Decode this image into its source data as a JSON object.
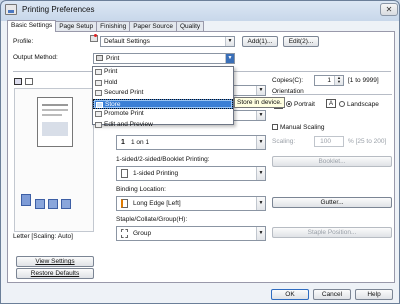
{
  "window": {
    "title": "Printing Preferences",
    "close": "✕"
  },
  "tabs": [
    "Basic Settings",
    "Page Setup",
    "Finishing",
    "Paper Source",
    "Quality"
  ],
  "profile": {
    "label": "Profile:",
    "value": "Default Settings",
    "add": "Add(1)...",
    "edit": "Edit(2)..."
  },
  "output_method": {
    "label": "Output Method:",
    "value": "Print",
    "options": [
      "Print",
      "Hold",
      "Secured Print",
      "Store",
      "Promote Print",
      "Edit and Preview"
    ],
    "selected_index": 3
  },
  "tooltip": "Store in device.",
  "copies": {
    "label": "Copies(C):",
    "value": "1",
    "range": "[1 to 9999]"
  },
  "orientation": {
    "label": "Orientation",
    "portrait": "Portrait",
    "landscape": "Landscape"
  },
  "layout_value": "1 on 1",
  "sided": {
    "label": "1-sided/2-sided/Booklet Printing:",
    "value": "1-sided Printing"
  },
  "binding": {
    "label": "Binding Location:",
    "value": "Long Edge [Left]",
    "gutter": "Gutter..."
  },
  "staple": {
    "label": "Staple/Collate/Group(H):",
    "value": "Group",
    "position": "Staple Position..."
  },
  "scaling": {
    "label": "Manual Scaling",
    "scaling_label": "Scaling:",
    "value": "100",
    "range": "% [25 to 200]"
  },
  "booklet": "Booklet...",
  "preview_caption": "Letter [Scaling: Auto]",
  "view_settings": "View Settings",
  "restore_defaults": "Restore Defaults",
  "footer": {
    "ok": "OK",
    "cancel": "Cancel",
    "help": "Help"
  },
  "colors": {
    "selection": "#3a7fd5",
    "window_bg": "#dce7f4"
  }
}
